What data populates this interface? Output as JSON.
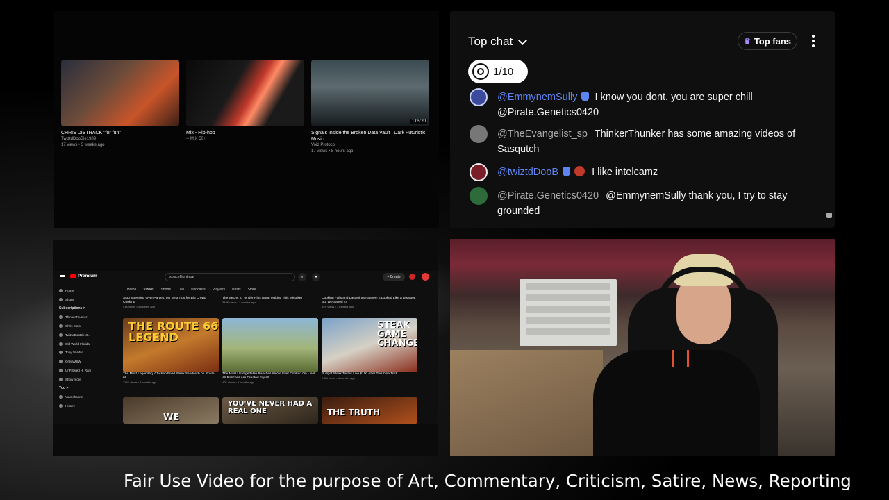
{
  "recommendations": [
    {
      "title": "CHRIS DISTRACK \"for fun\"",
      "channel": "TwiztdDooBie1989",
      "meta": "17 views • 3 weeks ago",
      "duration": ""
    },
    {
      "title": "Mix - Hip-hop",
      "channel": "•• MIX 50+",
      "meta": "",
      "duration": ""
    },
    {
      "title": "Signals Inside the Broken Data Vault | Dark Futuristic Music",
      "channel": "Void Protocol",
      "meta": "17 views • 8 hours ago",
      "duration": "1:05:20"
    }
  ],
  "chat": {
    "header": "Top chat",
    "top_fans_label": "Top fans",
    "counter": "1/10",
    "messages": [
      {
        "author": "@EmmynemSully",
        "text": "I know you dont. you are super chill @Pirate.Genetics0420",
        "moderator": true,
        "avatar_color": "#3b4a9c"
      },
      {
        "author": "@TheEvangelist_sp",
        "text": "ThinkerThunker has some amazing videos of Sasqutch",
        "moderator": false,
        "avatar_color": "#777777"
      },
      {
        "author": "@twiztdDooB",
        "text": "I like intelcamz",
        "moderator": true,
        "avatar_color": "#7a1f2a"
      },
      {
        "author": "@Pirate.Genetics0420",
        "text": "@EmmynemSully thank you, I try to stay grounded",
        "moderator": false,
        "avatar_color": "#2e6b3a"
      }
    ]
  },
  "youtube": {
    "logo": "Premium",
    "search_value": "spaceflightnow",
    "create_label": "+ Create",
    "sidebar": [
      {
        "label": "Home",
        "type": "item"
      },
      {
        "label": "Shorts",
        "type": "item"
      },
      {
        "label": "Subscriptions >",
        "type": "section"
      },
      {
        "label": "ThinkerThunker",
        "type": "sub"
      },
      {
        "label": "Chris Sims",
        "type": "sub"
      },
      {
        "label": "TwiztdDooBie19...",
        "type": "sub"
      },
      {
        "label": "Old World Florida",
        "type": "sub"
      },
      {
        "label": "Tony Ye-Man",
        "type": "sub"
      },
      {
        "label": "OnlyaMSW",
        "type": "sub"
      },
      {
        "label": "UnFiltered H. Ram",
        "type": "sub"
      },
      {
        "label": "Show more",
        "type": "item"
      },
      {
        "label": "You >",
        "type": "section"
      },
      {
        "label": "Your channel",
        "type": "item"
      },
      {
        "label": "History",
        "type": "item"
      }
    ],
    "tabs": [
      "Home",
      "Videos",
      "Shorts",
      "Live",
      "Podcasts",
      "Playlists",
      "Posts",
      "Store"
    ],
    "active_tab": "Videos",
    "top_row": [
      {
        "title": "Stop Stressing Over Parties: My Best Tips for Big Crowd Cooking",
        "meta": "51K views • 3 months ago"
      },
      {
        "title": "The Secret to Tender Ribs (Stop Making This Mistake)",
        "meta": "348K views • 3 months ago"
      },
      {
        "title": "Cooking Fails and Last Minute Saves! It Looked Like a Disaster, But We Saved It!",
        "meta": "34K views • 3 months ago"
      }
    ],
    "mid_row": [
      {
        "title": "The Most Legendary Chicken Fried Steak Sandwich on Route 66",
        "meta": "214K views • 3 months ago",
        "thumb_text": "THE ROUTE 66 LEGEND"
      },
      {
        "title": "The Most Unforgettable Ranches We've Ever Cooked On - Not All Ranches Are Created Equal!",
        "meta": "40K views • 3 months ago",
        "thumb_text": ""
      },
      {
        "title": "Budget Steak Tastes Like $100 After This One Trick",
        "meta": "2.5M views • 4 months ago",
        "thumb_text": "STEAK GAME CHANGER"
      }
    ],
    "bottom_row": [
      {
        "thumb_text": "WE"
      },
      {
        "thumb_text": "YOU'VE NEVER HAD A REAL ONE"
      },
      {
        "thumb_text": "THE TRUTH"
      }
    ]
  },
  "footer_text": "Fair Use Video for the purpose of Art, Commentary, Criticism, Satire, News, Reporting"
}
